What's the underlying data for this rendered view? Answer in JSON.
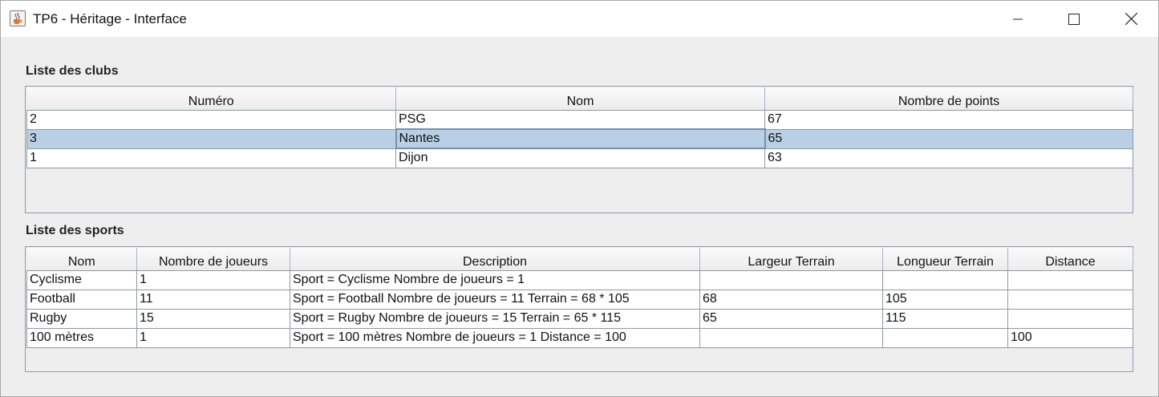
{
  "window": {
    "title": "TP6 - Héritage - Interface",
    "icon": "java-cup-icon",
    "controls": [
      "minimize-icon",
      "maximize-icon",
      "close-icon"
    ]
  },
  "clubs": {
    "label": "Liste des clubs",
    "columns": [
      "Numéro",
      "Nom",
      "Nombre de points"
    ],
    "rows": [
      {
        "numero": "2",
        "nom": "PSG",
        "points": "67",
        "selected": false
      },
      {
        "numero": "3",
        "nom": "Nantes",
        "points": "65",
        "selected": true
      },
      {
        "numero": "1",
        "nom": "Dijon",
        "points": "63",
        "selected": false
      }
    ]
  },
  "sports": {
    "label": "Liste des sports",
    "columns": [
      "Nom",
      "Nombre de joueurs",
      "Description",
      "Largeur Terrain",
      "Longueur Terrain",
      "Distance"
    ],
    "rows": [
      {
        "nom": "Cyclisme",
        "joueurs": "1",
        "description": "Sport = Cyclisme Nombre de joueurs = 1",
        "largeur": "",
        "longueur": "",
        "distance": ""
      },
      {
        "nom": "Football",
        "joueurs": "11",
        "description": "Sport = Football Nombre de joueurs = 11 Terrain = 68 * 105",
        "largeur": "68",
        "longueur": "105",
        "distance": ""
      },
      {
        "nom": "Rugby",
        "joueurs": "15",
        "description": "Sport = Rugby Nombre de joueurs = 15 Terrain = 65 * 115",
        "largeur": "65",
        "longueur": "115",
        "distance": ""
      },
      {
        "nom": "100 mètres",
        "joueurs": "1",
        "description": "Sport = 100 mètres Nombre de joueurs = 1 Distance = 100",
        "largeur": "",
        "longueur": "",
        "distance": "100"
      }
    ]
  },
  "colors": {
    "selection": "#b8cfe5",
    "grid": "#8f98a6",
    "panel": "#eeeeee"
  }
}
